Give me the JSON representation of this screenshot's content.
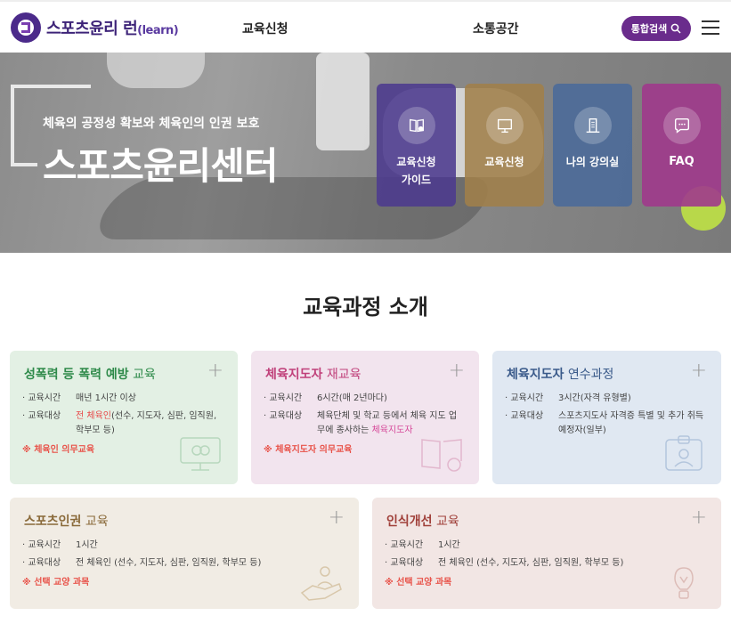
{
  "header": {
    "logo_text": "스포츠윤리 런",
    "logo_sub": "(learn)",
    "nav": [
      "교육신청",
      "소통공간"
    ],
    "search_label": "통합검색"
  },
  "hero": {
    "subtitle": "체육의 공정성 확보와 체육인의 인권 보호",
    "title": "스포츠윤리센터",
    "quick_links": [
      {
        "label": "교육신청\n가이드",
        "color": "#4c3a8e",
        "icon": "book-info-icon"
      },
      {
        "label": "교육신청",
        "color": "#a0804a",
        "icon": "presentation-icon"
      },
      {
        "label": "나의 강의실",
        "color": "#4a6a9a",
        "icon": "building-icon"
      },
      {
        "label": "FAQ",
        "color": "#a03a8c",
        "icon": "chat-bubble-icon"
      }
    ]
  },
  "section": {
    "title": "교육과정 소개"
  },
  "courses": [
    {
      "title_em": "성폭력 등 폭력 예방",
      "title_rest": " 교육",
      "title_color": "#2e8a4a",
      "bg": "#e3f0e4",
      "rows": [
        {
          "k": "교육시간",
          "v": "매년 1시간 이상"
        },
        {
          "k": "교육대상",
          "v_hl": "전 체육인",
          "v": "(선수, 지도자, 심판, 임직원, 학부모 등)"
        }
      ],
      "note": "※ 체육인 의무교육"
    },
    {
      "title_em": "체육지도자",
      "title_rest": " 재교육",
      "title_color": "#c0407a",
      "bg": "#f2e4ee",
      "rows": [
        {
          "k": "교육시간",
          "v": "6시간(매 2년마다)"
        },
        {
          "k": "교육대상",
          "v": "체육단체 및 학교 등에서 체육 지도 업무에 종사하는 ",
          "v_hl": "체육지도자"
        }
      ],
      "note": "※ 체육지도자 의무교육"
    },
    {
      "title_em": "체육지도자",
      "title_rest": " 연수과정",
      "title_color": "#3a5a8a",
      "bg": "#e0e8f2",
      "rows": [
        {
          "k": "교육시간",
          "v": "3시간(자격 유형별)"
        },
        {
          "k": "교육대상",
          "v": "스포츠지도사 자격증 특별 및 추가 취득 예정자(일부)"
        }
      ],
      "note": ""
    },
    {
      "title_em": "스포츠인권",
      "title_rest": " 교육",
      "title_color": "#8a6a3a",
      "bg": "#f1ece4",
      "rows": [
        {
          "k": "교육시간",
          "v": "1시간"
        },
        {
          "k": "교육대상",
          "v": "전 체육인 (선수, 지도자, 심판, 임직원, 학부모 등)"
        }
      ],
      "note": "※ 선택 교양 과목"
    },
    {
      "title_em": "인식개선",
      "title_rest": " 교육",
      "title_color": "#a0403a",
      "bg": "#f2e6e4",
      "rows": [
        {
          "k": "교육시간",
          "v": "1시간"
        },
        {
          "k": "교육대상",
          "v": "전 체육인 (선수, 지도자, 심판, 임직원, 학부모 등)"
        }
      ],
      "note": "※ 선택 교양 과목"
    }
  ],
  "colors": {
    "brand": "#4b2a8a",
    "search_button": "#6a2c8c"
  }
}
